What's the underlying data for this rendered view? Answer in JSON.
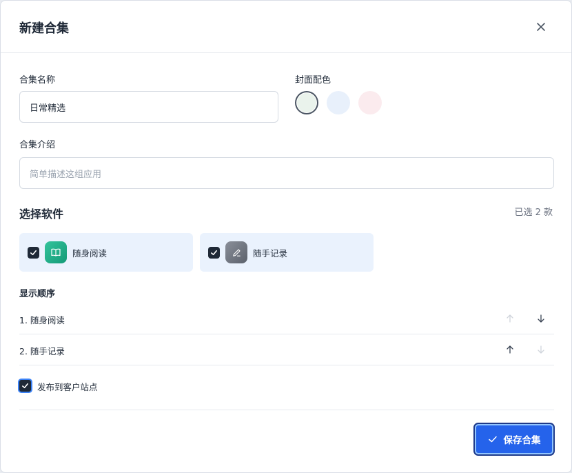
{
  "dialog": {
    "title": "新建合集"
  },
  "form": {
    "name_label": "合集名称",
    "name_value": "日常精选",
    "color_label": "封面配色",
    "colors": [
      "#eaf3ec",
      "#e8f0fb",
      "#fbebee"
    ],
    "selected_color_index": 0,
    "intro_label": "合集介绍",
    "intro_placeholder": "简单描述这组应用"
  },
  "software": {
    "title": "选择软件",
    "count_text": "已选 2 款",
    "apps": [
      {
        "name": "随身阅读",
        "icon": "book-icon",
        "checked": true,
        "color": "#22b38c"
      },
      {
        "name": "随手记录",
        "icon": "pen-icon",
        "checked": true,
        "color": "#6b7280"
      }
    ]
  },
  "order": {
    "title": "显示顺序",
    "items": [
      {
        "label": "1. 随身阅读"
      },
      {
        "label": "2. 随手记录"
      }
    ]
  },
  "publish": {
    "label": "发布到客户站点",
    "checked": true
  },
  "footer": {
    "save_label": "保存合集"
  }
}
